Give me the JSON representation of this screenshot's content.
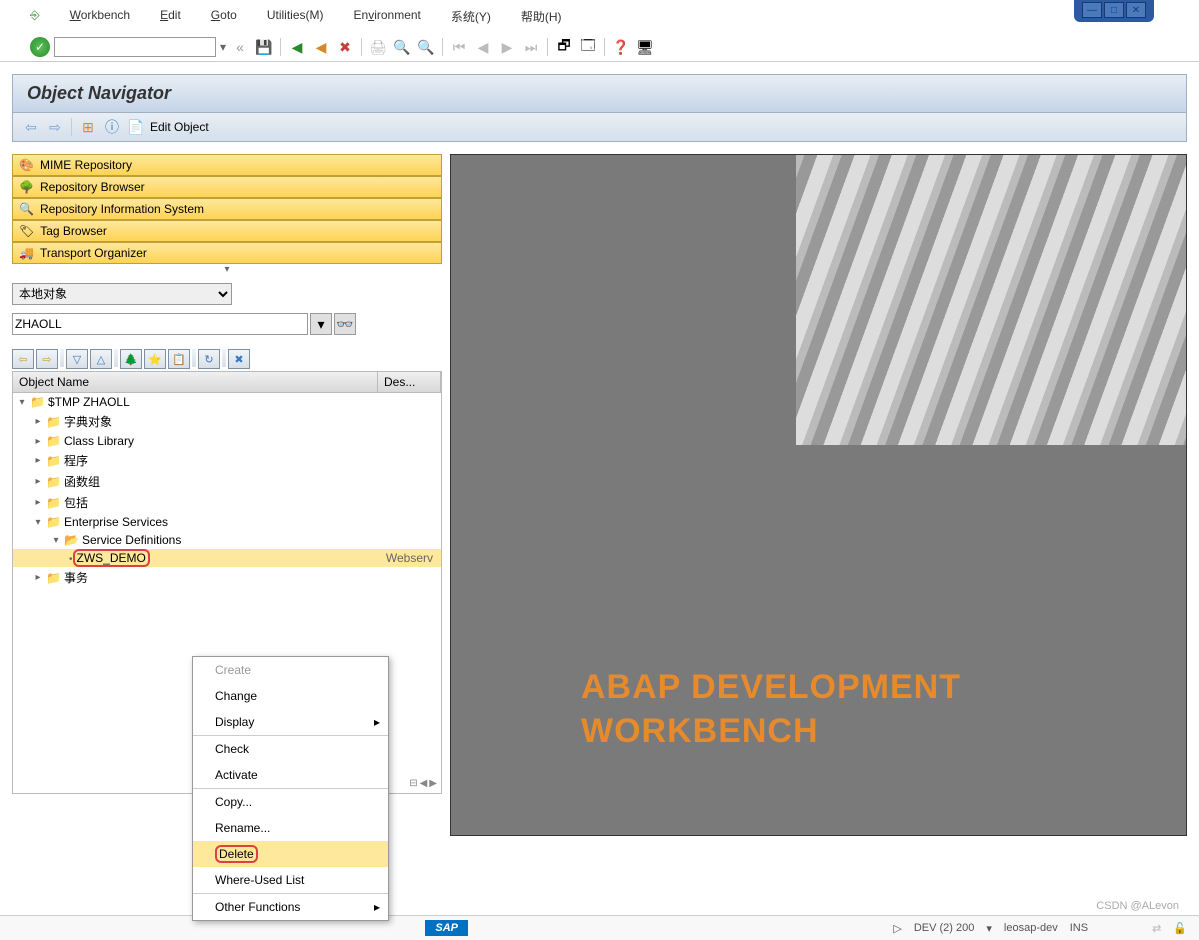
{
  "menu": {
    "workbench": "Workbench",
    "edit": "Edit",
    "goto": "Goto",
    "utilities": "Utilities(M)",
    "environment": "Environment",
    "system": "系统(Y)",
    "help": "帮助(H)"
  },
  "title": "Object Navigator",
  "edit_object": "Edit Object",
  "browsers": {
    "mime": "MIME Repository",
    "repo": "Repository Browser",
    "info": "Repository Information System",
    "tag": "Tag Browser",
    "transport": "Transport Organizer"
  },
  "dropdown": {
    "local": "本地对象",
    "user": "ZHAOLL"
  },
  "tree_header": {
    "name": "Object Name",
    "desc": "Des..."
  },
  "tree": {
    "root": "$TMP ZHAOLL",
    "dict": "字典对象",
    "class": "Class Library",
    "prog": "程序",
    "func": "函数组",
    "incl": "包括",
    "es": "Enterprise Services",
    "sd": "Service Definitions",
    "zws": "ZWS_DEMO",
    "zws_desc": "Webserv",
    "trans": "事务"
  },
  "context": {
    "create": "Create",
    "change": "Change",
    "display": "Display",
    "check": "Check",
    "activate": "Activate",
    "copy": "Copy...",
    "rename": "Rename...",
    "delete": "Delete",
    "where": "Where-Used List",
    "other": "Other Functions"
  },
  "banner": {
    "l1": "ABAP DEVELOPMENT",
    "l2": "WORKBENCH"
  },
  "status": {
    "sys": "DEV (2) 200",
    "host": "leosap-dev",
    "mode": "INS",
    "sap": "SAP"
  },
  "watermark": "CSDN @ALevon"
}
